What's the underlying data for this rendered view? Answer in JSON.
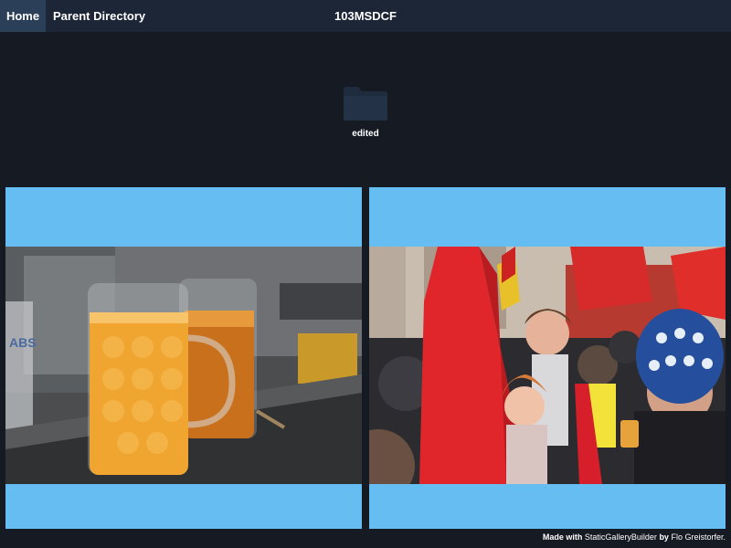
{
  "nav": {
    "home_label": "Home",
    "parent_label": "Parent Directory"
  },
  "page": {
    "title": "103MSDCF"
  },
  "folders": [
    {
      "name": "edited",
      "icon": "folder-icon"
    }
  ],
  "photos": [
    {
      "subject": "two glass beer mugs filled with orange drink on a counter"
    },
    {
      "subject": "crowd at a demonstration with red flags"
    }
  ],
  "footer": {
    "made_with": "Made with",
    "tool": "StaticGalleryBuilder",
    "by": "by",
    "author": "Flo Greistorfer",
    "end": "."
  },
  "colors": {
    "background": "#161a22",
    "topbar": "#1c2636",
    "home_active": "#2c3f58",
    "tile_background": "#65bdf2",
    "folder": "#1f2c3d"
  }
}
